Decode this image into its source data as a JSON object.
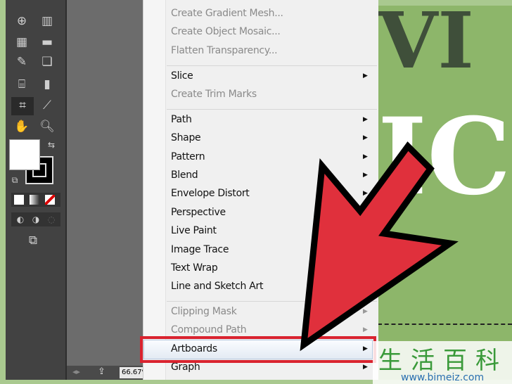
{
  "menu": {
    "items": [
      {
        "label": "Create Gradient Mesh...",
        "disabled": true
      },
      {
        "label": "Create Object Mosaic...",
        "disabled": true
      },
      {
        "label": "Flatten Transparency...",
        "disabled": true
      },
      {
        "label": "Slice",
        "submenu": true
      },
      {
        "label": "Create Trim Marks",
        "disabled": true
      },
      {
        "label": "Path",
        "submenu": true
      },
      {
        "label": "Shape",
        "submenu": true
      },
      {
        "label": "Pattern",
        "submenu": true
      },
      {
        "label": "Blend",
        "submenu": true
      },
      {
        "label": "Envelope Distort",
        "submenu": true
      },
      {
        "label": "Perspective"
      },
      {
        "label": "Live Paint"
      },
      {
        "label": "Image Trace"
      },
      {
        "label": "Text Wrap"
      },
      {
        "label": "Line and Sketch Art"
      },
      {
        "label": "Clipping Mask",
        "disabled": true,
        "submenu": true
      },
      {
        "label": "Compound Path",
        "disabled": true,
        "submenu": true
      },
      {
        "label": "Artboards",
        "submenu": true,
        "highlighted": true
      },
      {
        "label": "Graph",
        "submenu": true
      }
    ]
  },
  "status": {
    "zoom": "66.67%"
  },
  "watermark": {
    "chinese": "生活百科",
    "url": "www.bimeiz.com"
  },
  "colors": {
    "highlight_box": "#d9232f",
    "arrow": "#e0303c",
    "artwork": "#8db66a"
  }
}
